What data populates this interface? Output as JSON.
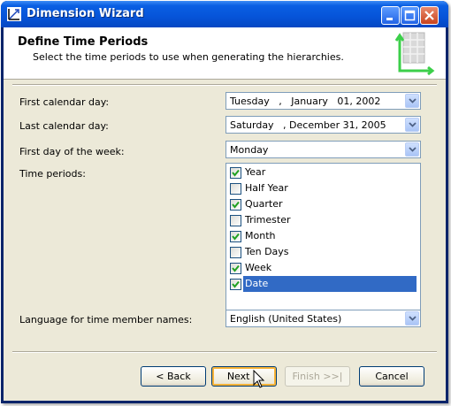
{
  "window": {
    "title": "Dimension Wizard",
    "icon": "wizard-icon"
  },
  "header": {
    "title": "Define Time Periods",
    "subtitle": "Select the time periods to use when generating the hierarchies."
  },
  "form": {
    "first_calendar_day": {
      "label": "First calendar day:",
      "value": "Tuesday   ,   January   01, 2002"
    },
    "last_calendar_day": {
      "label": "Last calendar day:",
      "value": "Saturday   , December 31, 2005"
    },
    "first_day_of_week": {
      "label": "First day of the week:",
      "value": "Monday"
    },
    "time_periods_label": "Time periods:",
    "time_periods": [
      {
        "label": "Year",
        "checked": true
      },
      {
        "label": "Half Year",
        "checked": false
      },
      {
        "label": "Quarter",
        "checked": true
      },
      {
        "label": "Trimester",
        "checked": false
      },
      {
        "label": "Month",
        "checked": true
      },
      {
        "label": "Ten Days",
        "checked": false
      },
      {
        "label": "Week",
        "checked": true
      },
      {
        "label": "Date",
        "checked": true,
        "selected": true
      }
    ],
    "language": {
      "label": "Language for time member names:",
      "value": "English (United States)"
    }
  },
  "buttons": {
    "back": "< Back",
    "next": "Next >",
    "finish": "Finish >>|",
    "cancel": "Cancel"
  },
  "colors": {
    "selection": "#316ac5",
    "titlebar": "#0654d9"
  }
}
